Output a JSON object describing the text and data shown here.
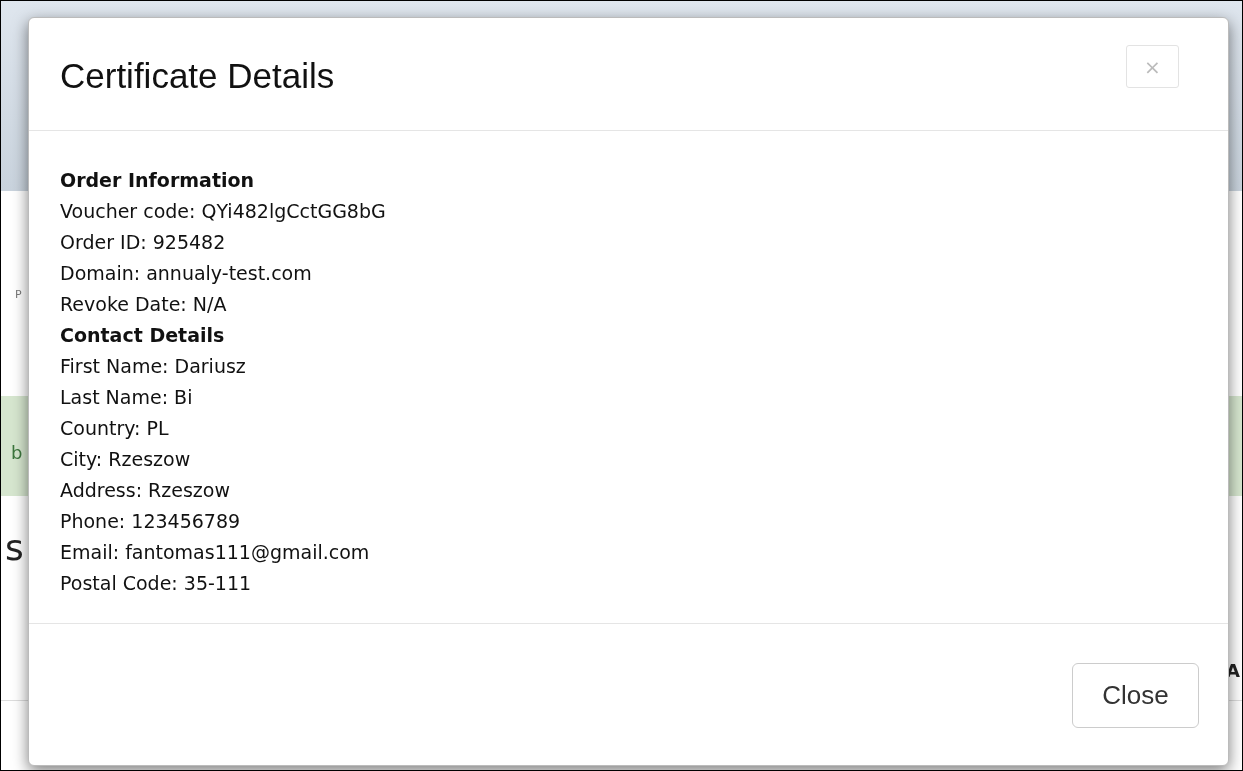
{
  "background": {
    "fragments": [
      {
        "text": "P",
        "kind": "tab"
      },
      {
        "text": "b",
        "kind": "alert"
      },
      {
        "text": "s",
        "kind": "heading"
      },
      {
        "text": "A",
        "kind": "column"
      }
    ]
  },
  "dialog": {
    "title": "Certificate Details",
    "close_icon": "×",
    "sections": [
      {
        "heading": "Order Information",
        "lines": [
          "Voucher code: QYi482lgCctGG8bG",
          "Order ID: 925482",
          "Domain: annualy-test.com",
          "Revoke Date: N/A"
        ]
      },
      {
        "heading": "Contact Details",
        "lines": [
          "First Name: Dariusz",
          "Last Name: Bi",
          "Country: PL",
          "City: Rzeszow",
          "Address: Rzeszow",
          "Phone: 123456789",
          "Email: fantomas111@gmail.com",
          "Postal Code: 35-111"
        ]
      }
    ],
    "buttons": [
      "Close"
    ]
  }
}
